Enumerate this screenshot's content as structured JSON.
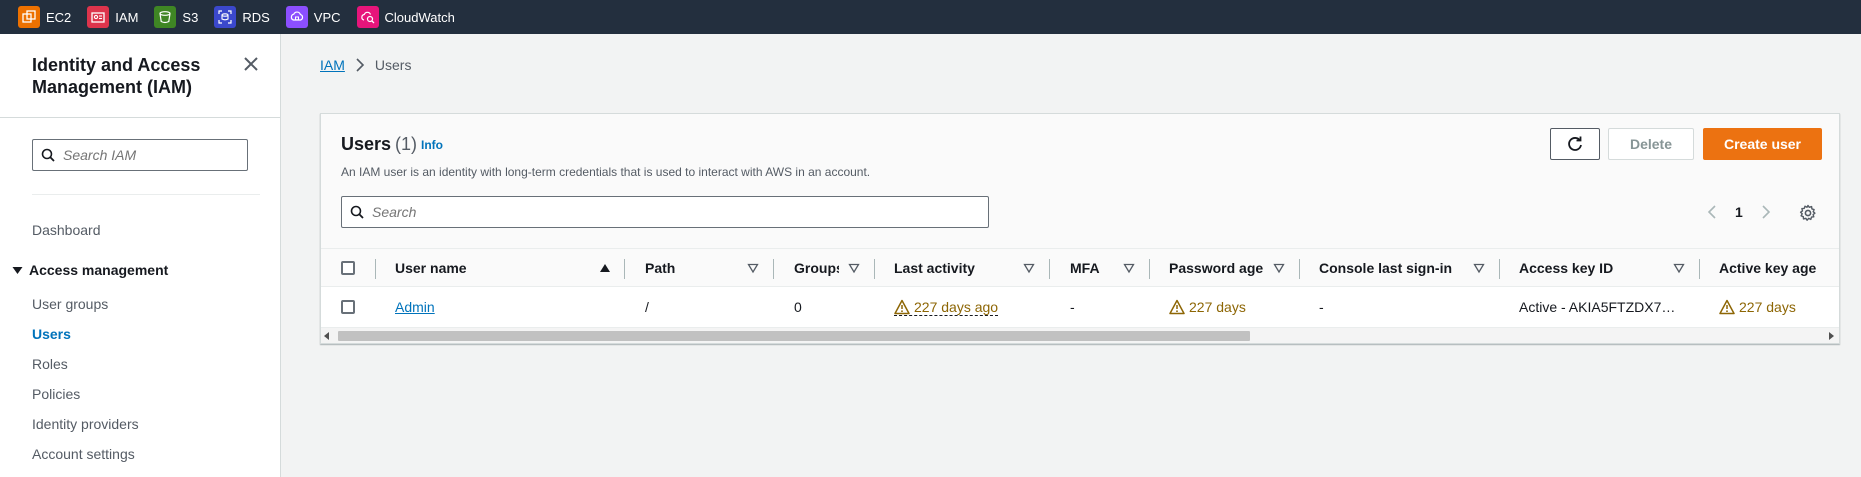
{
  "topbar": {
    "services": [
      {
        "label": "EC2",
        "icon": "ec2-icon",
        "color": "#ed7100"
      },
      {
        "label": "IAM",
        "icon": "iam-icon",
        "color": "#dd344c"
      },
      {
        "label": "S3",
        "icon": "s3-icon",
        "color": "#3f8624"
      },
      {
        "label": "RDS",
        "icon": "rds-icon",
        "color": "#3b48cc"
      },
      {
        "label": "VPC",
        "icon": "vpc-icon",
        "color": "#8c4fff"
      },
      {
        "label": "CloudWatch",
        "icon": "cloudwatch-icon",
        "color": "#e7157b"
      }
    ]
  },
  "sidebar": {
    "title": "Identity and Access Management (IAM)",
    "search_placeholder": "Search IAM",
    "dashboard": "Dashboard",
    "section": "Access management",
    "items": [
      "User groups",
      "Users",
      "Roles",
      "Policies",
      "Identity providers",
      "Account settings"
    ],
    "active_item": "Users"
  },
  "breadcrumb": {
    "root": "IAM",
    "current": "Users"
  },
  "panel": {
    "title": "Users",
    "count": "(1)",
    "info": "Info",
    "description": "An IAM user is an identity with long-term credentials that is used to interact with AWS in an account.",
    "search_placeholder": "Search",
    "delete_label": "Delete",
    "create_label": "Create user",
    "page": "1"
  },
  "table": {
    "columns": [
      "User name",
      "Path",
      "Groups",
      "Last activity",
      "MFA",
      "Password age",
      "Console last sign-in",
      "Access key ID",
      "Active key age"
    ],
    "rows": [
      {
        "user_name": "Admin",
        "path": "/",
        "groups": "0",
        "last_activity": "227 days ago",
        "mfa": "-",
        "password_age": "227 days",
        "console_last_sign_in": "-",
        "access_key_id": "Active - AKIA5FTZDX7…",
        "active_key_age": "227 days"
      }
    ]
  },
  "colors": {
    "topbar": "#232f3e",
    "link": "#0073bb",
    "primary_button": "#ec7211",
    "warning": "#8d6605"
  }
}
